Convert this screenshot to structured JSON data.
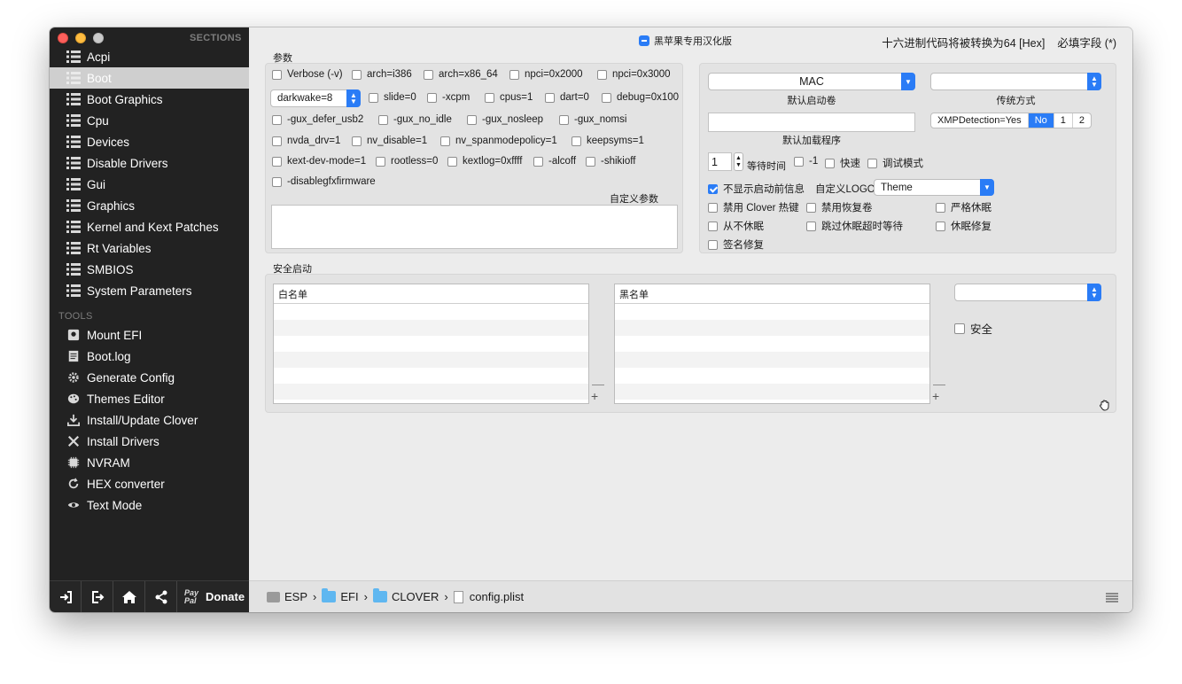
{
  "sidebar": {
    "sections_header": "SECTIONS",
    "tools_header": "TOOLS",
    "sections": [
      {
        "label": "Acpi",
        "icon": "list-icon"
      },
      {
        "label": "Boot",
        "icon": "list-icon",
        "selected": true
      },
      {
        "label": "Boot Graphics",
        "icon": "list-icon"
      },
      {
        "label": "Cpu",
        "icon": "list-icon"
      },
      {
        "label": "Devices",
        "icon": "list-icon"
      },
      {
        "label": "Disable Drivers",
        "icon": "list-icon"
      },
      {
        "label": "Gui",
        "icon": "list-icon"
      },
      {
        "label": "Graphics",
        "icon": "list-icon"
      },
      {
        "label": "Kernel and Kext Patches",
        "icon": "list-icon"
      },
      {
        "label": "Rt Variables",
        "icon": "list-icon"
      },
      {
        "label": "SMBIOS",
        "icon": "list-icon"
      },
      {
        "label": "System Parameters",
        "icon": "list-icon"
      }
    ],
    "tools": [
      {
        "label": "Mount EFI",
        "icon": "disk-icon"
      },
      {
        "label": "Boot.log",
        "icon": "log-icon"
      },
      {
        "label": "Generate Config",
        "icon": "gear-icon"
      },
      {
        "label": "Themes Editor",
        "icon": "palette-icon"
      },
      {
        "label": "Install/Update Clover",
        "icon": "download-icon"
      },
      {
        "label": "Install Drivers",
        "icon": "tools-icon"
      },
      {
        "label": "NVRAM",
        "icon": "chip-icon"
      },
      {
        "label": "HEX converter",
        "icon": "refresh-icon"
      },
      {
        "label": "Text Mode",
        "icon": "eye-icon"
      }
    ],
    "bottom": {
      "paypal_top": "Pay",
      "paypal_bottom": "Pal",
      "donate_label": "Donate"
    }
  },
  "header": {
    "localized_check_label": "黑苹果专用汉化版",
    "hex_note": "十六进制代码将被转换为64 [Hex]",
    "required_note": "必填字段 (*)"
  },
  "args": {
    "group_label": "参数",
    "custom_label": "自定义参数",
    "custom_value": "",
    "darkwake_value": "darkwake=8",
    "rows": [
      [
        "Verbose (-v)",
        "arch=i386",
        "arch=x86_64",
        "npci=0x2000",
        "npci=0x3000"
      ],
      [
        "slide=0",
        "-xcpm",
        "cpus=1",
        "dart=0",
        "debug=0x100"
      ],
      [
        "-gux_defer_usb2",
        "-gux_no_idle",
        "-gux_nosleep",
        "-gux_nomsi"
      ],
      [
        "nvda_drv=1",
        "nv_disable=1",
        "nv_spanmodepolicy=1",
        "keepsyms=1"
      ],
      [
        "kext-dev-mode=1",
        "rootless=0",
        "kextlog=0xffff",
        "-alcoff",
        "-shikioff"
      ],
      [
        "-disablegfxfirmware"
      ]
    ]
  },
  "boot": {
    "default_volume_value": "MAC",
    "default_volume_label": "默认启动卷",
    "legacy_value": "",
    "legacy_label": "传统方式",
    "default_loader_value": "",
    "default_loader_label": "默认加载程序",
    "xmp_label": "XMPDetection=Yes",
    "xmp_options": [
      "No",
      "1",
      "2"
    ],
    "xmp_selected": "No",
    "timeout_value": "1",
    "timeout_label": "等待时间",
    "minus_one_label": "-1",
    "fast_label": "快速",
    "debug_label": "调试模式",
    "hide_msgs_label": "不显示启动前信息",
    "custom_logo_label": "自定义LOGO",
    "theme_value": "Theme",
    "disable_hotkeys_label": "禁用 Clover 热键",
    "disable_recovery_label": "禁用恢复卷",
    "strict_hibernate_label": "严格休眠",
    "never_hibernate_label": "从不休眠",
    "skip_hibernate_timeout_label": "跳过休眠超时等待",
    "hibernate_fix_label": "休眠修复",
    "signature_fix_label": "签名修复"
  },
  "secure": {
    "group_label": "安全启动",
    "whitelist_header": "白名单",
    "blacklist_header": "黑名单",
    "mode_value": "",
    "secure_label": "安全",
    "minus": "—",
    "plus": "+"
  },
  "breadcrumb": {
    "items": [
      {
        "label": "ESP",
        "icon": "drive-icon"
      },
      {
        "label": "EFI",
        "icon": "folder-icon"
      },
      {
        "label": "CLOVER",
        "icon": "folder-icon"
      },
      {
        "label": "config.plist",
        "icon": "file-icon"
      }
    ],
    "separator": "›"
  }
}
